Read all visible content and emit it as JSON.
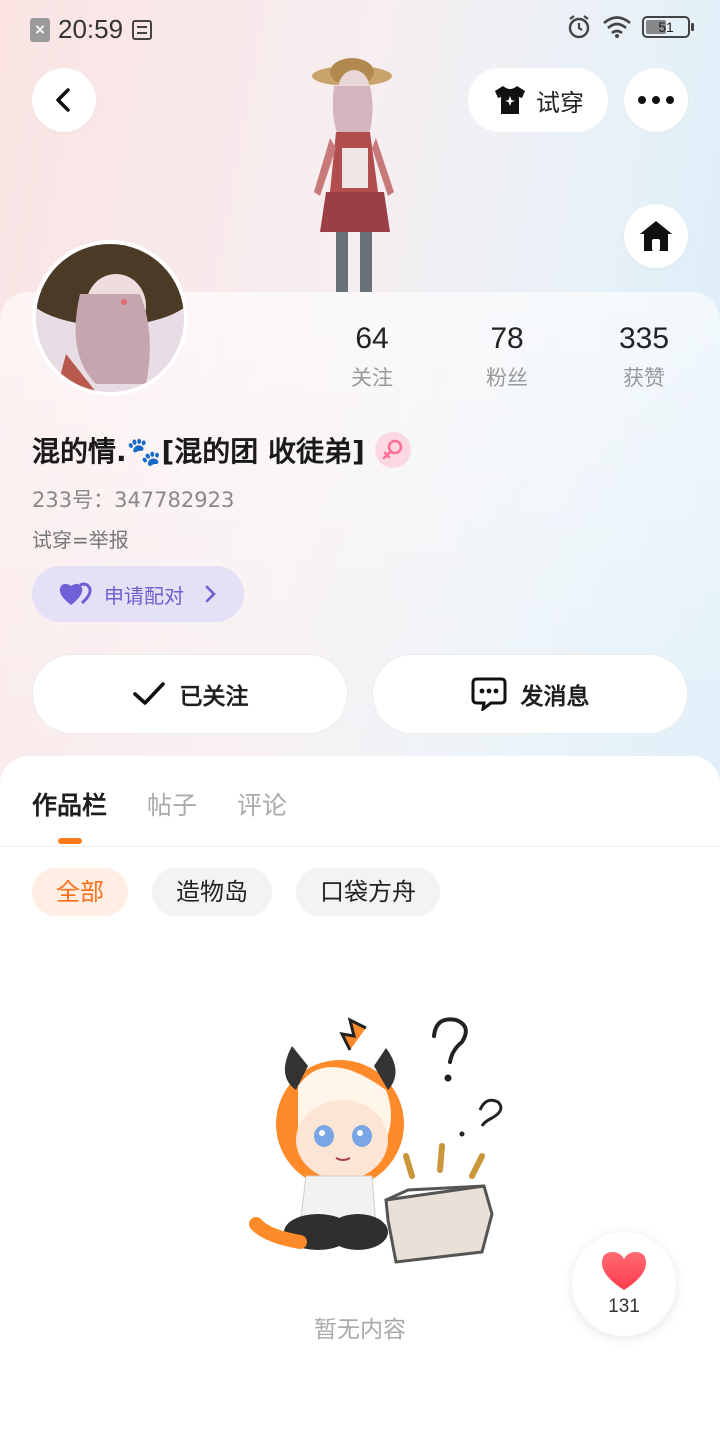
{
  "status_bar": {
    "time": "20:59",
    "battery": "51"
  },
  "header": {
    "tryon_label": "试穿"
  },
  "profile": {
    "stats": [
      {
        "num": "64",
        "label": "关注"
      },
      {
        "num": "78",
        "label": "粉丝"
      },
      {
        "num": "335",
        "label": "获赞"
      }
    ],
    "username": "混的情.🐾[混的团 收徒弟]",
    "uid": "233号：347782923",
    "bio": "试穿=举报",
    "pair_label": "申请配对"
  },
  "actions": {
    "follow_label": "已关注",
    "message_label": "发消息"
  },
  "tabs": [
    {
      "label": "作品栏"
    },
    {
      "label": "帖子"
    },
    {
      "label": "评论"
    }
  ],
  "filters": [
    {
      "label": "全部"
    },
    {
      "label": "造物岛"
    },
    {
      "label": "口袋方舟"
    }
  ],
  "empty_state": {
    "text": "暂无内容"
  },
  "like_float": {
    "count": "131"
  },
  "colors": {
    "accent": "#ff7a1a",
    "pair": "#6e5fd0",
    "heart": "#ff4d5e"
  }
}
